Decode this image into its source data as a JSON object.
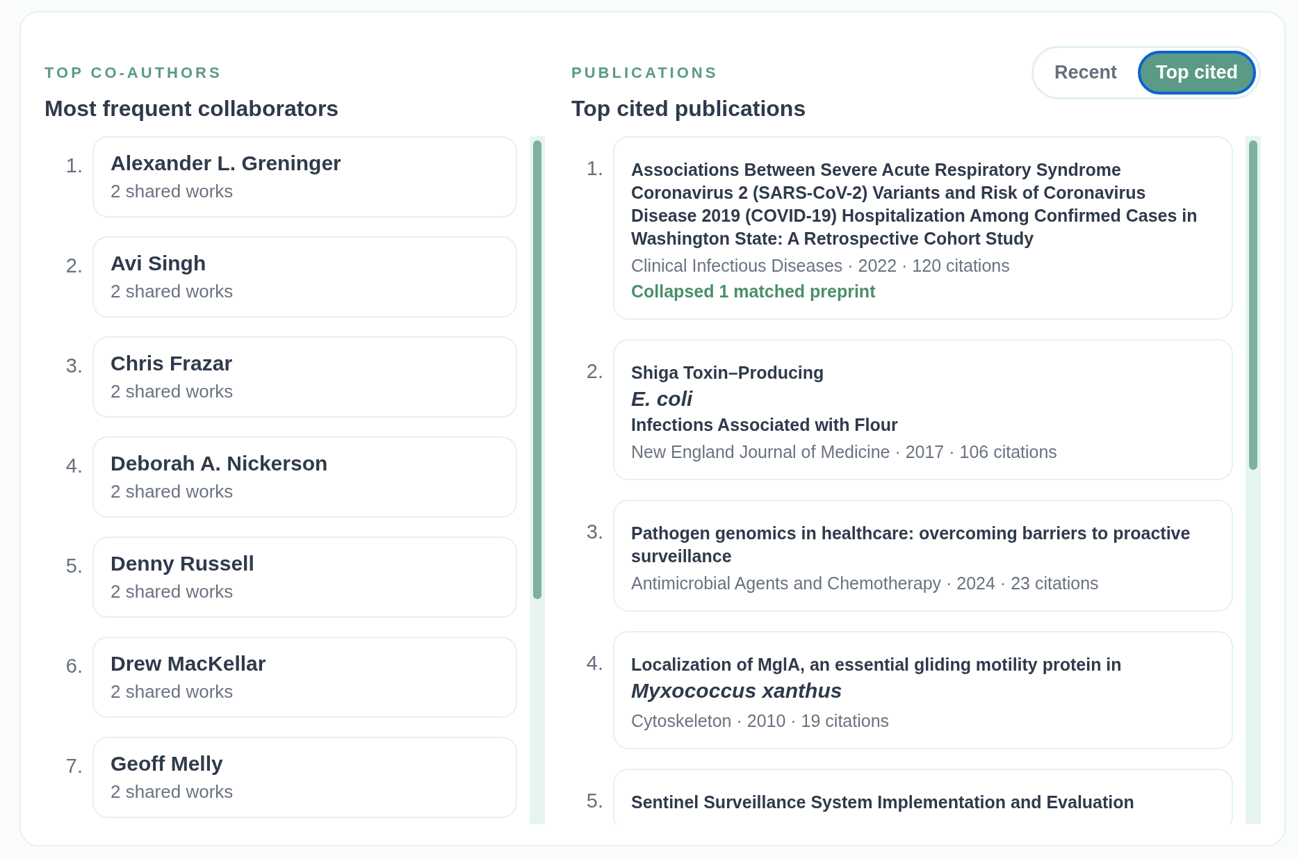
{
  "coauthors": {
    "eyebrow": "TOP CO-AUTHORS",
    "title": "Most frequent collaborators",
    "items": [
      {
        "rank": "1.",
        "name": "Alexander L. Greninger",
        "detail": "2 shared works"
      },
      {
        "rank": "2.",
        "name": "Avi Singh",
        "detail": "2 shared works"
      },
      {
        "rank": "3.",
        "name": "Chris Frazar",
        "detail": "2 shared works"
      },
      {
        "rank": "4.",
        "name": "Deborah A. Nickerson",
        "detail": "2 shared works"
      },
      {
        "rank": "5.",
        "name": "Denny Russell",
        "detail": "2 shared works"
      },
      {
        "rank": "6.",
        "name": "Drew MacKellar",
        "detail": "2 shared works"
      },
      {
        "rank": "7.",
        "name": "Geoff Melly",
        "detail": "2 shared works"
      }
    ]
  },
  "publications": {
    "eyebrow": "PUBLICATIONS",
    "title": "Top cited publications",
    "tabs": [
      {
        "label": "Recent",
        "selected": false
      },
      {
        "label": "Top cited",
        "selected": true
      }
    ],
    "items": [
      {
        "rank": "1.",
        "title": "Associations Between Severe Acute Respiratory Syndrome Coronavirus 2 (SARS-CoV-2) Variants and Risk of Coronavirus Disease 2019 (COVID-19) Hospitalization Among Confirmed Cases in Washington State: A Retrospective Cohort Study",
        "meta": "Clinical Infectious Diseases · 2022 · 120 citations",
        "note": "Collapsed 1 matched preprint"
      },
      {
        "rank": "2.",
        "title": "Shiga Toxin–Producing *E. coli* Infections Associated with Flour",
        "meta": "New England Journal of Medicine · 2017 · 106 citations"
      },
      {
        "rank": "3.",
        "title": "Pathogen genomics in healthcare: overcoming barriers to proactive surveillance",
        "meta": "Antimicrobial Agents and Chemotherapy · 2024 · 23 citations"
      },
      {
        "rank": "4.",
        "title": "Localization of MglA, an essential gliding motility protein in *Myxococcus xanthus*",
        "meta": "Cytoskeleton · 2010 · 19 citations"
      },
      {
        "rank": "5.",
        "title": "Sentinel Surveillance System Implementation and Evaluation"
      }
    ]
  }
}
